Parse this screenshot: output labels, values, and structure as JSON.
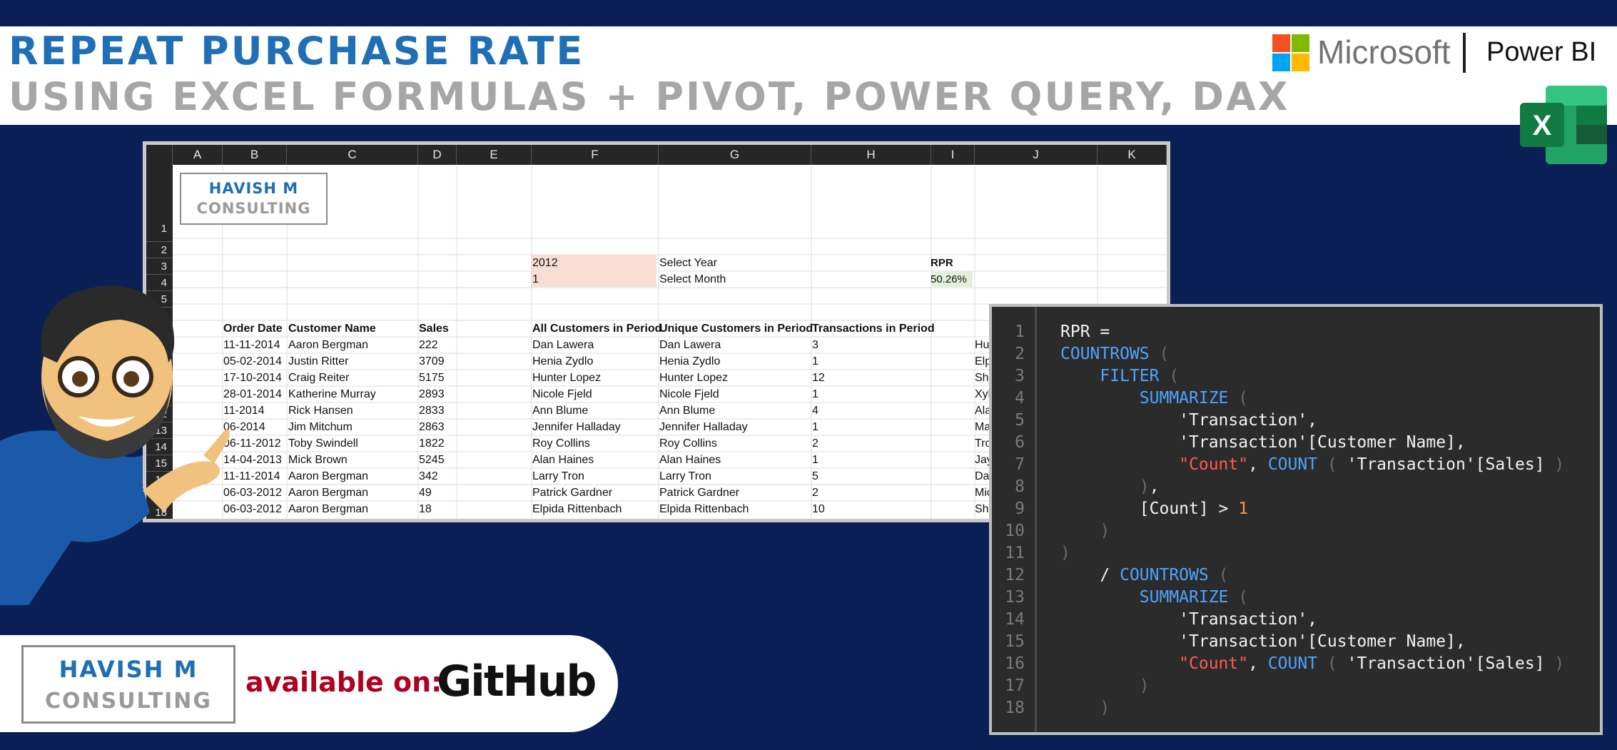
{
  "header": {
    "title_line1": "REPEAT PURCHASE RATE",
    "title_line2": "USING EXCEL FORMULAS + PIVOT, POWER QUERY, DAX",
    "microsoft_label": "Microsoft",
    "powerbi_label": "Power BI",
    "excel_icon_letter": "X"
  },
  "sheet": {
    "columns": [
      "A",
      "B",
      "C",
      "D",
      "E",
      "F",
      "G",
      "H",
      "I",
      "J",
      "K"
    ],
    "rows": [
      "1",
      "2",
      "3",
      "4",
      "5",
      "",
      "",
      "12",
      "13",
      "14",
      "15",
      "16",
      "18"
    ],
    "logo_line1": "HAVISH M",
    "logo_line2": "CONSULTING",
    "year_value": "2012",
    "year_label": "Select Year",
    "month_value": "1",
    "month_label": "Select Month",
    "rpr_label": "RPR",
    "rpr_value": "50.26%",
    "headers": {
      "order_date": "Order Date",
      "customer_name": "Customer Name",
      "sales": "Sales",
      "all_customers": "All Customers in Period",
      "unique_customers": "Unique Customers in Period",
      "transactions": "Transactions in Period"
    },
    "data_rows": [
      {
        "date": "11-11-2014",
        "name": "Aaron Bergman",
        "sales": "222",
        "all": "Dan Lawera",
        "unique": "Dan Lawera",
        "tx": "3"
      },
      {
        "date": "05-02-2014",
        "name": "Justin Ritter",
        "sales": "3709",
        "all": "Henia Zydlo",
        "unique": "Henia Zydlo",
        "tx": "1"
      },
      {
        "date": "17-10-2014",
        "name": "Craig Reiter",
        "sales": "5175",
        "all": "Hunter Lopez",
        "unique": "Hunter Lopez",
        "tx": "12"
      },
      {
        "date": "28-01-2014",
        "name": "Katherine Murray",
        "sales": "2893",
        "all": "Nicole Fjeld",
        "unique": "Nicole Fjeld",
        "tx": "1"
      },
      {
        "date": "11-2014",
        "name": "Rick Hansen",
        "sales": "2833",
        "all": "Ann Blume",
        "unique": "Ann Blume",
        "tx": "4"
      },
      {
        "date": "06-2014",
        "name": "Jim Mitchum",
        "sales": "2863",
        "all": "Jennifer Halladay",
        "unique": "Jennifer Halladay",
        "tx": "1"
      },
      {
        "date": "06-11-2012",
        "name": "Toby Swindell",
        "sales": "1822",
        "all": "Roy Collins",
        "unique": "Roy Collins",
        "tx": "2"
      },
      {
        "date": "14-04-2013",
        "name": "Mick Brown",
        "sales": "5245",
        "all": "Alan Haines",
        "unique": "Alan Haines",
        "tx": "1"
      },
      {
        "date": "11-11-2014",
        "name": "Aaron Bergman",
        "sales": "342",
        "all": "Larry Tron",
        "unique": "Larry Tron",
        "tx": "5"
      },
      {
        "date": "06-03-2012",
        "name": "Aaron Bergman",
        "sales": "49",
        "all": "Patrick Gardner",
        "unique": "Patrick Gardner",
        "tx": "2"
      },
      {
        "date": "06-03-2012",
        "name": "Aaron Bergman",
        "sales": "18",
        "all": "Elpida Rittenbach",
        "unique": "Elpida Rittenbach",
        "tx": "10"
      }
    ],
    "partial_j": [
      "Hu",
      "Elp",
      "Shi",
      "Xyl",
      "Ala",
      "Ma",
      "Tro",
      "Jay",
      "Dav",
      "Mic",
      "Sha"
    ]
  },
  "code": {
    "line_numbers": [
      "1",
      "2",
      "3",
      "4",
      "5",
      "6",
      "7",
      "8",
      "9",
      "10",
      "11",
      "12",
      "13",
      "14",
      "15",
      "16",
      "17",
      "18"
    ]
  },
  "badge": {
    "logo_line1": "HAVISH M",
    "logo_line2": "CONSULTING",
    "available": "available on:",
    "github": "GitHub"
  },
  "colors": {
    "background": "#0a1f55",
    "title_blue": "#1f6fb6",
    "title_gray": "#a6a6a6",
    "code_bg": "#2b2b2b",
    "keyword": "#4ea3ff",
    "string": "#ff5a4d",
    "number": "#f59a3a"
  }
}
